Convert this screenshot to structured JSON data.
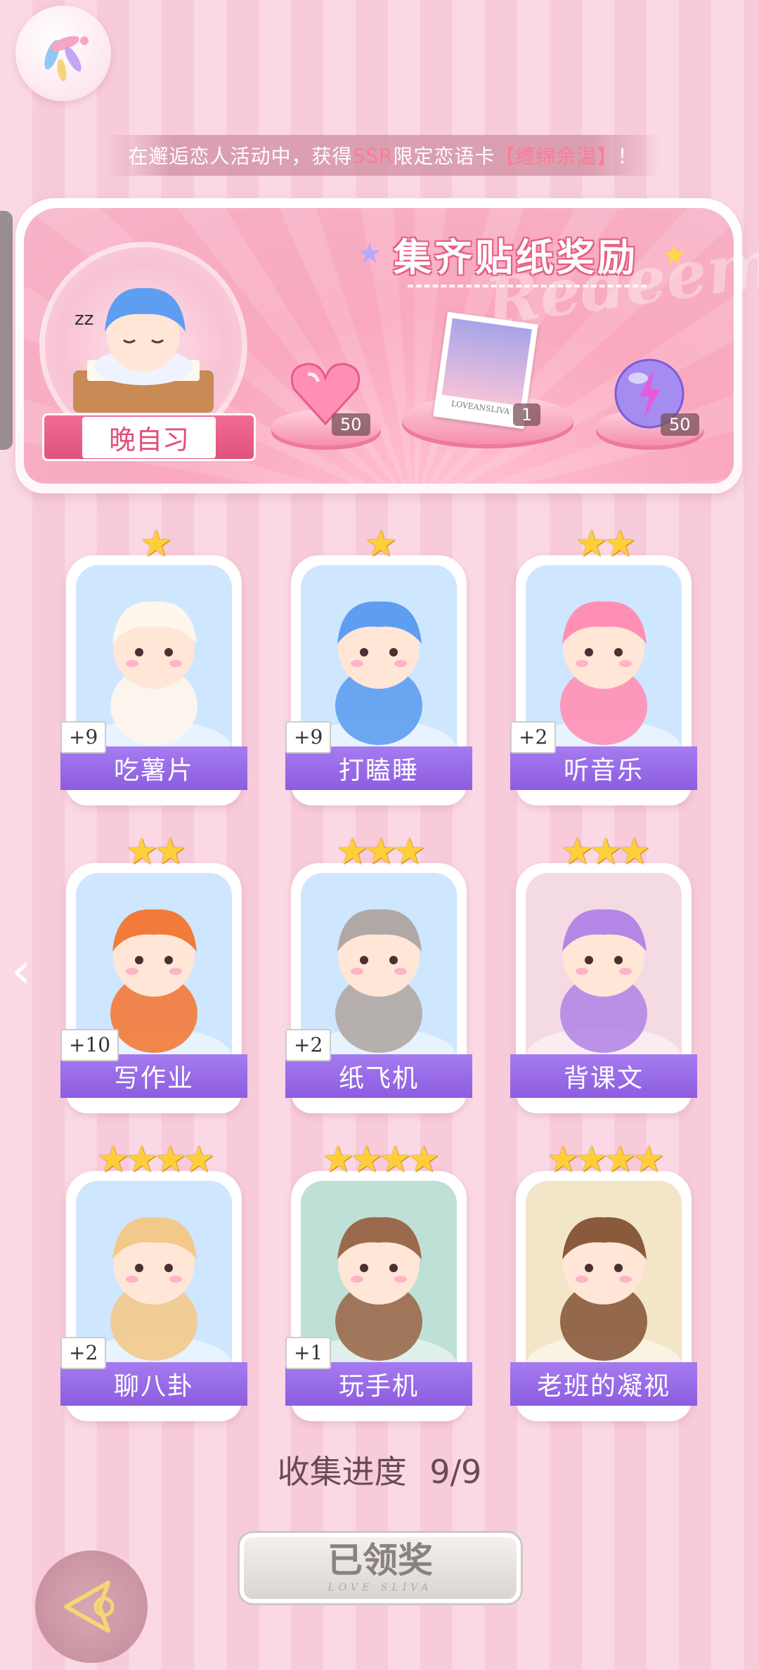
{
  "notice": {
    "prefix": "在邂逅恋人活动中，获得",
    "ssr": "SSR",
    "mid": "限定恋语卡",
    "card": "【缠绵余温】",
    "suffix": "！"
  },
  "banner": {
    "title": "集齐贴纸奖励",
    "watermark": "Redeem",
    "character_label": "晚自习",
    "rewards": [
      {
        "icon": "heart-gem-icon",
        "count": "50"
      },
      {
        "icon": "photo-card-icon",
        "count": "1",
        "caption": "LOVEANSLIVA"
      },
      {
        "icon": "lightning-orb-icon",
        "count": "50"
      }
    ]
  },
  "cards": [
    {
      "label": "吃薯片",
      "bonus": "+9",
      "stars": "★",
      "art": "fox-eating-chips"
    },
    {
      "label": "打瞌睡",
      "bonus": "+9",
      "stars": "★",
      "art": "boy-sleeping-on-desk"
    },
    {
      "label": "听音乐",
      "bonus": "+2",
      "stars": "★★",
      "art": "girl-with-headphones"
    },
    {
      "label": "写作业",
      "bonus": "+10",
      "stars": "★★",
      "art": "boy-writing-homework"
    },
    {
      "label": "纸飞机",
      "bonus": "+2",
      "stars": "★★★",
      "art": "cat-on-paper-plane"
    },
    {
      "label": "背课文",
      "bonus": "",
      "stars": "★★★",
      "art": "girl-reading-in-classroom"
    },
    {
      "label": "聊八卦",
      "bonus": "+2",
      "stars": "★★★★",
      "art": "puppy-with-watermelon"
    },
    {
      "label": "玩手机",
      "bonus": "+1",
      "stars": "★★★★",
      "art": "girl-playing-phone"
    },
    {
      "label": "老班的凝视",
      "bonus": "",
      "stars": "★★★★",
      "art": "teacher-with-glasses"
    }
  ],
  "progress": {
    "label": "收集进度",
    "value": "9/9"
  },
  "claim_button": {
    "label": "已领奖",
    "sub": "LOVE SLIVA"
  },
  "colors": {
    "label_purple": "#9466e6",
    "pink": "#f06c94",
    "star_gold": "#ffcf3a"
  }
}
